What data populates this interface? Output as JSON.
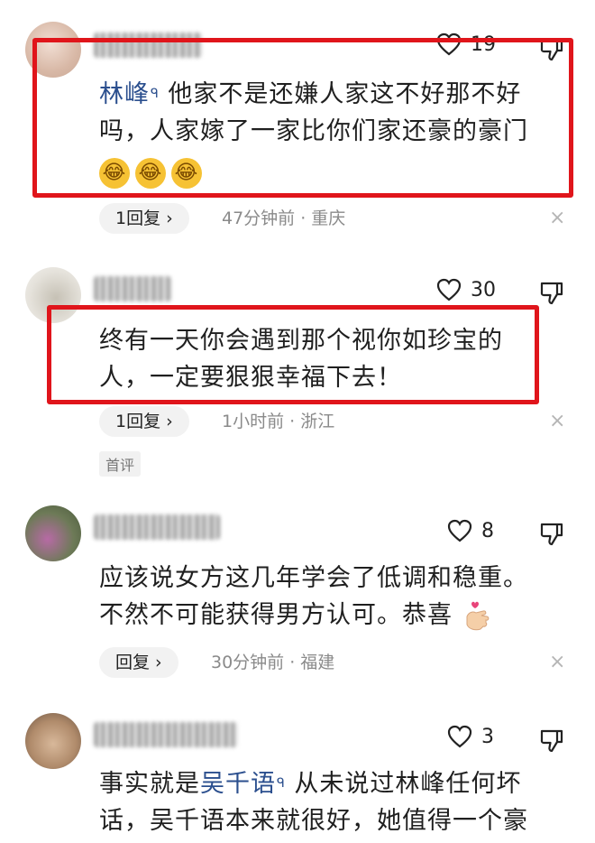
{
  "comments": [
    {
      "likes": "19",
      "mention": "林峰",
      "text_lines": [
        "他家不是还嫌人家这不好那不好",
        "吗，人家嫁了一家比你们家还豪的豪门"
      ],
      "emojis": [
        "😂",
        "😂",
        "😂"
      ],
      "reply_label": "1回复 ›",
      "time_location": "47分钟前 · 重庆"
    },
    {
      "likes": "30",
      "text_lines": [
        "终有一天你会遇到那个视你如珍宝的",
        "人，一定要狠狠幸福下去！"
      ],
      "reply_label": "1回复 ›",
      "time_location": "1小时前 · 浙江",
      "badge": "首评"
    },
    {
      "likes": "8",
      "text_lines": [
        "应该说女方这几年学会了低调和稳重。",
        "不然不可能获得男方认可。恭喜"
      ],
      "reply_label": "回复 ›",
      "time_location": "30分钟前 · 福建"
    },
    {
      "likes": "3",
      "prefix": "事实就是",
      "mention": "吴千语",
      "line1_rest": " 从未说过林峰任何坏",
      "line2": "话，吴千语本来就很好，她值得一个豪"
    }
  ],
  "close_glyph": "×",
  "colors": {
    "highlight": "#e0151b",
    "mention": "#2b4f8e"
  },
  "icons": [
    "heart-icon",
    "thumbs-down-icon",
    "close-icon",
    "search-icon"
  ]
}
